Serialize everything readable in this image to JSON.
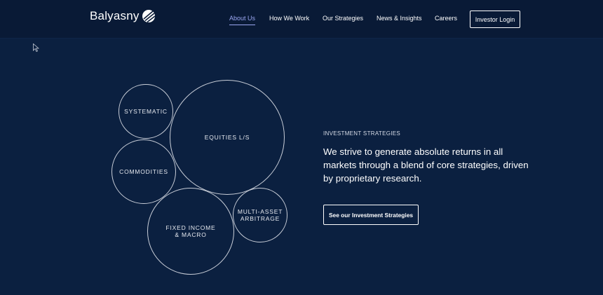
{
  "brand": {
    "name": "Balyasny",
    "logo_icon": "balyasny-swoosh-mark"
  },
  "nav": {
    "items": [
      {
        "label": "About Us",
        "active": true
      },
      {
        "label": "How We Work",
        "active": false
      },
      {
        "label": "Our Strategies",
        "active": false
      },
      {
        "label": "News & Insights",
        "active": false
      },
      {
        "label": "Careers",
        "active": false
      }
    ],
    "login_label": "Investor Login"
  },
  "strategies": {
    "bubbles": [
      {
        "label": "SYSTEMATIC"
      },
      {
        "label": "EQUITIES L/S"
      },
      {
        "label": "COMMODITIES"
      },
      {
        "label": "MULTI-ASSET\nARBITRAGE"
      },
      {
        "label": "FIXED INCOME\n& MACRO"
      }
    ],
    "eyebrow": "INVESTMENT STRATEGIES",
    "headline": "We strive to generate absolute returns in all markets through a blend of core strategies, driven by proprietary research.",
    "cta_label": "See our Investment Strategies"
  },
  "colors": {
    "background": "#0b2040",
    "header": "#091a36",
    "active_nav": "#9aa6f0",
    "outline": "#c9ced8"
  }
}
